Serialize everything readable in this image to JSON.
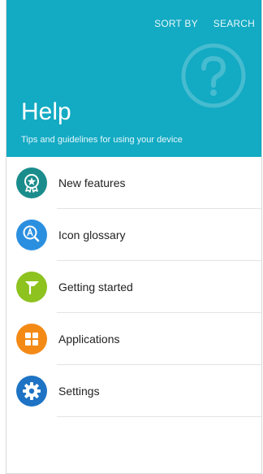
{
  "header": {
    "sort_label": "SORT BY",
    "search_label": "SEARCH",
    "title": "Help",
    "subtitle": "Tips and guidelines for using your device",
    "color": "#13aac3"
  },
  "menu": [
    {
      "label": "New features",
      "icon": "star-badge-icon",
      "color": "#1a8c8c"
    },
    {
      "label": "Icon glossary",
      "icon": "search-a-icon",
      "color": "#2b8fe0"
    },
    {
      "label": "Getting started",
      "icon": "flag-icon",
      "color": "#8dc21f"
    },
    {
      "label": "Applications",
      "icon": "grid-icon",
      "color": "#f48a16"
    },
    {
      "label": "Settings",
      "icon": "gear-icon",
      "color": "#1e73c4"
    }
  ]
}
